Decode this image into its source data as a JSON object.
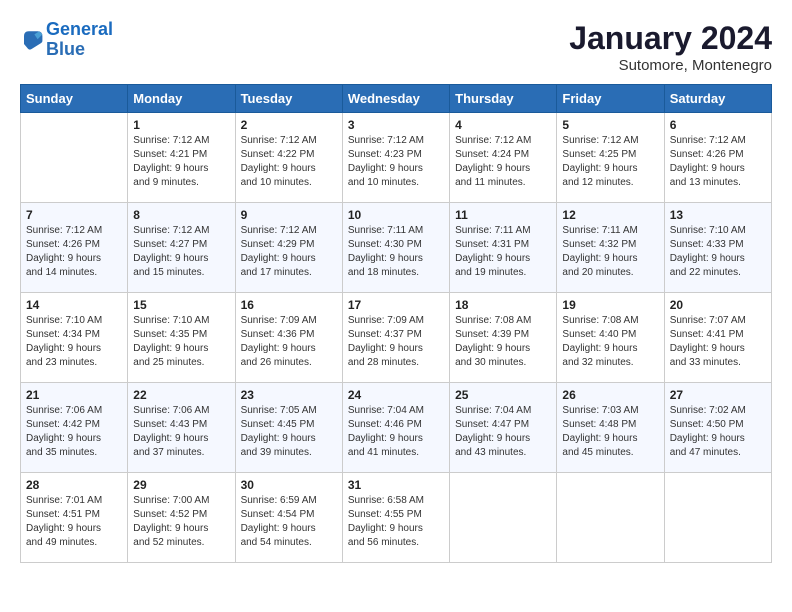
{
  "header": {
    "logo_line1": "General",
    "logo_line2": "Blue",
    "month": "January 2024",
    "location": "Sutomore, Montenegro"
  },
  "columns": [
    "Sunday",
    "Monday",
    "Tuesday",
    "Wednesday",
    "Thursday",
    "Friday",
    "Saturday"
  ],
  "weeks": [
    [
      {
        "day": "",
        "content": ""
      },
      {
        "day": "1",
        "content": "Sunrise: 7:12 AM\nSunset: 4:21 PM\nDaylight: 9 hours\nand 9 minutes."
      },
      {
        "day": "2",
        "content": "Sunrise: 7:12 AM\nSunset: 4:22 PM\nDaylight: 9 hours\nand 10 minutes."
      },
      {
        "day": "3",
        "content": "Sunrise: 7:12 AM\nSunset: 4:23 PM\nDaylight: 9 hours\nand 10 minutes."
      },
      {
        "day": "4",
        "content": "Sunrise: 7:12 AM\nSunset: 4:24 PM\nDaylight: 9 hours\nand 11 minutes."
      },
      {
        "day": "5",
        "content": "Sunrise: 7:12 AM\nSunset: 4:25 PM\nDaylight: 9 hours\nand 12 minutes."
      },
      {
        "day": "6",
        "content": "Sunrise: 7:12 AM\nSunset: 4:26 PM\nDaylight: 9 hours\nand 13 minutes."
      }
    ],
    [
      {
        "day": "7",
        "content": "Sunrise: 7:12 AM\nSunset: 4:26 PM\nDaylight: 9 hours\nand 14 minutes."
      },
      {
        "day": "8",
        "content": "Sunrise: 7:12 AM\nSunset: 4:27 PM\nDaylight: 9 hours\nand 15 minutes."
      },
      {
        "day": "9",
        "content": "Sunrise: 7:12 AM\nSunset: 4:29 PM\nDaylight: 9 hours\nand 17 minutes."
      },
      {
        "day": "10",
        "content": "Sunrise: 7:11 AM\nSunset: 4:30 PM\nDaylight: 9 hours\nand 18 minutes."
      },
      {
        "day": "11",
        "content": "Sunrise: 7:11 AM\nSunset: 4:31 PM\nDaylight: 9 hours\nand 19 minutes."
      },
      {
        "day": "12",
        "content": "Sunrise: 7:11 AM\nSunset: 4:32 PM\nDaylight: 9 hours\nand 20 minutes."
      },
      {
        "day": "13",
        "content": "Sunrise: 7:10 AM\nSunset: 4:33 PM\nDaylight: 9 hours\nand 22 minutes."
      }
    ],
    [
      {
        "day": "14",
        "content": "Sunrise: 7:10 AM\nSunset: 4:34 PM\nDaylight: 9 hours\nand 23 minutes."
      },
      {
        "day": "15",
        "content": "Sunrise: 7:10 AM\nSunset: 4:35 PM\nDaylight: 9 hours\nand 25 minutes."
      },
      {
        "day": "16",
        "content": "Sunrise: 7:09 AM\nSunset: 4:36 PM\nDaylight: 9 hours\nand 26 minutes."
      },
      {
        "day": "17",
        "content": "Sunrise: 7:09 AM\nSunset: 4:37 PM\nDaylight: 9 hours\nand 28 minutes."
      },
      {
        "day": "18",
        "content": "Sunrise: 7:08 AM\nSunset: 4:39 PM\nDaylight: 9 hours\nand 30 minutes."
      },
      {
        "day": "19",
        "content": "Sunrise: 7:08 AM\nSunset: 4:40 PM\nDaylight: 9 hours\nand 32 minutes."
      },
      {
        "day": "20",
        "content": "Sunrise: 7:07 AM\nSunset: 4:41 PM\nDaylight: 9 hours\nand 33 minutes."
      }
    ],
    [
      {
        "day": "21",
        "content": "Sunrise: 7:06 AM\nSunset: 4:42 PM\nDaylight: 9 hours\nand 35 minutes."
      },
      {
        "day": "22",
        "content": "Sunrise: 7:06 AM\nSunset: 4:43 PM\nDaylight: 9 hours\nand 37 minutes."
      },
      {
        "day": "23",
        "content": "Sunrise: 7:05 AM\nSunset: 4:45 PM\nDaylight: 9 hours\nand 39 minutes."
      },
      {
        "day": "24",
        "content": "Sunrise: 7:04 AM\nSunset: 4:46 PM\nDaylight: 9 hours\nand 41 minutes."
      },
      {
        "day": "25",
        "content": "Sunrise: 7:04 AM\nSunset: 4:47 PM\nDaylight: 9 hours\nand 43 minutes."
      },
      {
        "day": "26",
        "content": "Sunrise: 7:03 AM\nSunset: 4:48 PM\nDaylight: 9 hours\nand 45 minutes."
      },
      {
        "day": "27",
        "content": "Sunrise: 7:02 AM\nSunset: 4:50 PM\nDaylight: 9 hours\nand 47 minutes."
      }
    ],
    [
      {
        "day": "28",
        "content": "Sunrise: 7:01 AM\nSunset: 4:51 PM\nDaylight: 9 hours\nand 49 minutes."
      },
      {
        "day": "29",
        "content": "Sunrise: 7:00 AM\nSunset: 4:52 PM\nDaylight: 9 hours\nand 52 minutes."
      },
      {
        "day": "30",
        "content": "Sunrise: 6:59 AM\nSunset: 4:54 PM\nDaylight: 9 hours\nand 54 minutes."
      },
      {
        "day": "31",
        "content": "Sunrise: 6:58 AM\nSunset: 4:55 PM\nDaylight: 9 hours\nand 56 minutes."
      },
      {
        "day": "",
        "content": ""
      },
      {
        "day": "",
        "content": ""
      },
      {
        "day": "",
        "content": ""
      }
    ]
  ]
}
